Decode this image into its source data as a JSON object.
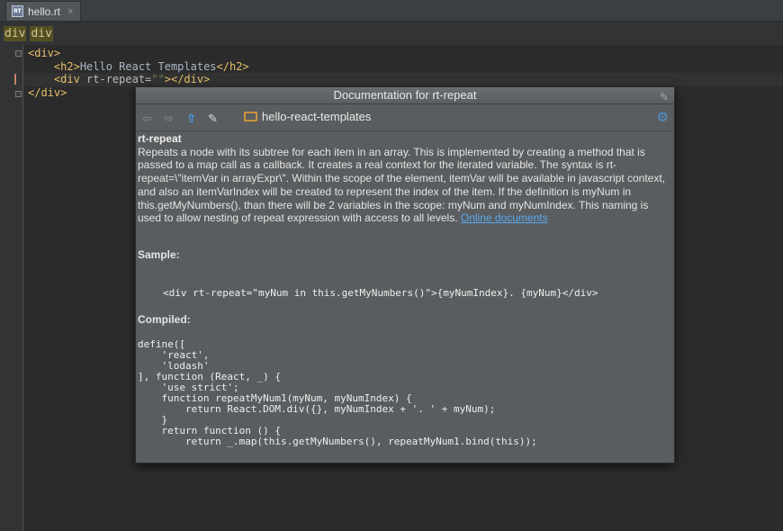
{
  "tab": {
    "icon_text": "RT",
    "label": "hello.rt",
    "close": "×"
  },
  "breadcrumbs": [
    "div",
    "div"
  ],
  "code_lines": [
    {
      "open": "<div>",
      "rest": ""
    },
    {
      "open": "<h2>",
      "text": "Hello React Templates",
      "close": "</h2>"
    },
    {
      "open": "<div",
      "attr": " rt-repeat=",
      "str": "\"\"",
      "close": "></div>"
    },
    {
      "open": "</div>"
    }
  ],
  "popup": {
    "title": "Documentation for rt-repeat",
    "breadcrumb_folder": "hello-react-templates",
    "heading": "rt-repeat",
    "description": "Repeats a node with its subtree for each item in an array. This is implemented by creating a method that is passed to a map call as a callback. It creates a real context for the iterated variable. The syntax is rt-repeat=\\\"itemVar in arrayExpr\\\". Within the scope of the element, itemVar will be available in javascript context, and also an itemVarIndex will be created to represent the index of the item. If the definition is myNum in this.getMyNumbers(), than there will be 2 variables in the scope: myNum and myNumIndex. This naming is used to allow nesting of repeat expression with access to all levels.",
    "link_label": "Online documents",
    "sample_label": "Sample:",
    "sample_code": "<div rt-repeat=\"myNum in this.getMyNumbers()\">{myNumIndex}. {myNum}</div>",
    "compiled_label": "Compiled:",
    "compiled_code": "define([\n    'react',\n    'lodash'\n], function (React, _) {\n    'use strict';\n    function repeatMyNum1(myNum, myNumIndex) {\n        return React.DOM.div({}, myNumIndex + '. ' + myNum);\n    }\n    return function () {\n        return _.map(this.getMyNumbers(), repeatMyNum1.bind(this));"
  },
  "icons": {
    "back": "arrow-left-icon",
    "forward": "arrow-right-icon",
    "up": "arrow-up-icon",
    "edit": "edit-source-icon",
    "folder": "folder-icon",
    "settings": "gear-icon",
    "pin": "pin-icon"
  }
}
